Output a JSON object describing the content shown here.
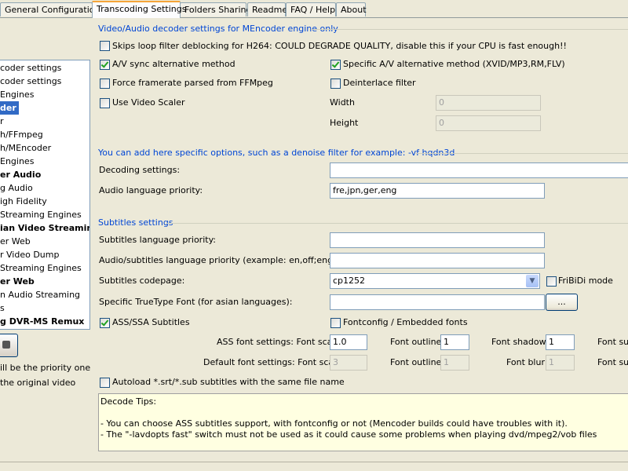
{
  "tabs": [
    {
      "label": "General Configuration",
      "active": false
    },
    {
      "label": "Transcoding Settings",
      "active": true
    },
    {
      "label": "Folders Sharing",
      "active": false
    },
    {
      "label": "Readme",
      "active": false
    },
    {
      "label": "FAQ / Help",
      "active": false
    },
    {
      "label": "About",
      "active": false
    }
  ],
  "left_panel": {
    "items": [
      {
        "label": "coder settings",
        "style": "normal"
      },
      {
        "label": "coder settings",
        "style": "normal"
      },
      {
        "label": "Engines",
        "style": "normal"
      },
      {
        "label": "der",
        "style": "selected"
      },
      {
        "label": "r",
        "style": "normal"
      },
      {
        "label": "h/FFmpeg",
        "style": "normal"
      },
      {
        "label": "h/MEncoder",
        "style": "normal"
      },
      {
        "label": "Engines",
        "style": "normal"
      },
      {
        "label": "er Audio",
        "style": "bold"
      },
      {
        "label": "g Audio",
        "style": "normal"
      },
      {
        "label": "igh Fidelity",
        "style": "normal"
      },
      {
        "label": "Streaming Engines",
        "style": "normal"
      },
      {
        "label": "ian Video Streaming",
        "style": "bold"
      },
      {
        "label": "er Web",
        "style": "normal"
      },
      {
        "label": "r Video Dump",
        "style": "normal"
      },
      {
        "label": "Streaming Engines",
        "style": "normal"
      },
      {
        "label": "er Web",
        "style": "bold"
      },
      {
        "label": "n Audio Streaming",
        "style": "normal"
      },
      {
        "label": "s",
        "style": "normal"
      },
      {
        "label": "g DVR-MS Remux",
        "style": "bold"
      }
    ],
    "priority_text": "ill be the priority one",
    "original_text": "the original video"
  },
  "decoder": {
    "title": "Video/Audio decoder settings for MEncoder engine only",
    "skip_loop_label": "Skips loop filter deblocking for H264: COULD DEGRADE QUALITY, disable this if your CPU is fast enough!!",
    "skip_loop_checked": false,
    "av_sync_label": "A/V sync alternative method",
    "av_sync_checked": true,
    "specific_av_label": "Specific A/V alternative method (XVID/MP3,RM,FLV)",
    "specific_av_checked": true,
    "force_framerate_label": "Force framerate parsed from FFMpeg",
    "force_framerate_checked": false,
    "deinterlace_label": "Deinterlace filter",
    "deinterlace_checked": false,
    "video_scaler_label": "Use Video Scaler",
    "video_scaler_checked": false,
    "width_label": "Width",
    "width_value": "0",
    "height_label": "Height",
    "height_value": "0"
  },
  "options": {
    "title": "You can add here specific options, such as a denoise filter for example: -vf hqdn3d",
    "decoding_label": "Decoding settings:",
    "decoding_value": "",
    "audio_lang_label": "Audio language priority:",
    "audio_lang_value": "fre,jpn,ger,eng"
  },
  "subtitles": {
    "title": "Subtitles settings",
    "sub_lang_label": "Subtitles language priority:",
    "sub_lang_value": "",
    "audio_sub_label": "Audio/subtitles language priority (example:  en,off;eng,off )",
    "audio_sub_value": "",
    "codepage_label": "Subtitles codepage:",
    "codepage_value": "cp1252",
    "fribidi_label": "FriBiDi mode",
    "fribidi_checked": false,
    "truetype_label": "Specific TrueType Font (for asian languages):",
    "truetype_value": "",
    "browse_label": "...",
    "ass_label": "ASS/SSA Subtitles",
    "ass_checked": true,
    "fontconfig_label": "Fontconfig / Embedded fonts",
    "fontconfig_checked": false,
    "ass_font_label": "ASS font settings: Font scale",
    "ass_font_scale": "1.0",
    "ass_outline_label": "Font outline",
    "ass_outline_value": "1",
    "ass_shadow_label": "Font shadow",
    "ass_shadow_value": "1",
    "ass_sub_label": "Font sub",
    "default_font_label": "Default font settings: Font scale",
    "default_font_scale": "3",
    "default_outline_label": "Font outline",
    "default_outline_value": "1",
    "default_blur_label": "Font blur",
    "default_blur_value": "1",
    "default_sub_label": "Font sub",
    "autoload_label": "Autoload *.srt/*.sub subtitles with the same file name",
    "autoload_checked": false
  },
  "tips": {
    "lines": [
      "Decode Tips:",
      "",
      "- You can choose ASS subtitles support, with fontconfig or not (Mencoder builds could have troubles with it).",
      "- The \"-lavdopts fast\" switch must not be used as it could cause some problems when playing dvd/mpeg2/vob files"
    ]
  }
}
